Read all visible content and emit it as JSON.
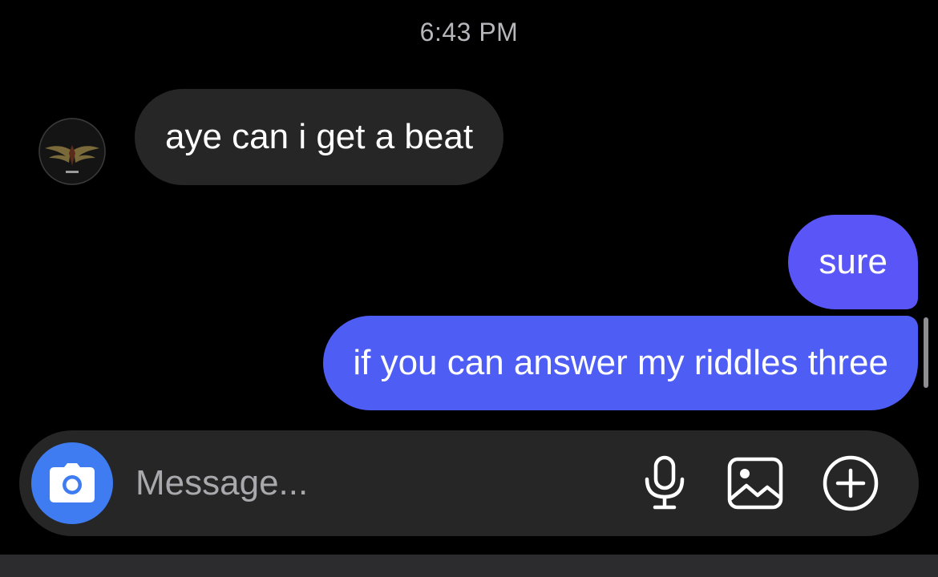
{
  "conversation": {
    "timestamp": "6:43 PM",
    "messages": [
      {
        "direction": "incoming",
        "text": "aye can i get a beat"
      },
      {
        "direction": "outgoing",
        "text": "sure"
      },
      {
        "direction": "outgoing",
        "text": "if you can answer my riddles three"
      }
    ]
  },
  "composer": {
    "placeholder": "Message...",
    "icons": [
      "camera-icon",
      "microphone-icon",
      "gallery-icon",
      "plus-circle-icon"
    ]
  },
  "colors": {
    "background": "#000000",
    "incoming_bubble": "#262626",
    "outgoing_bubble": "#5a55f7",
    "camera_button": "#3f7cf2",
    "composer": "#262626"
  }
}
